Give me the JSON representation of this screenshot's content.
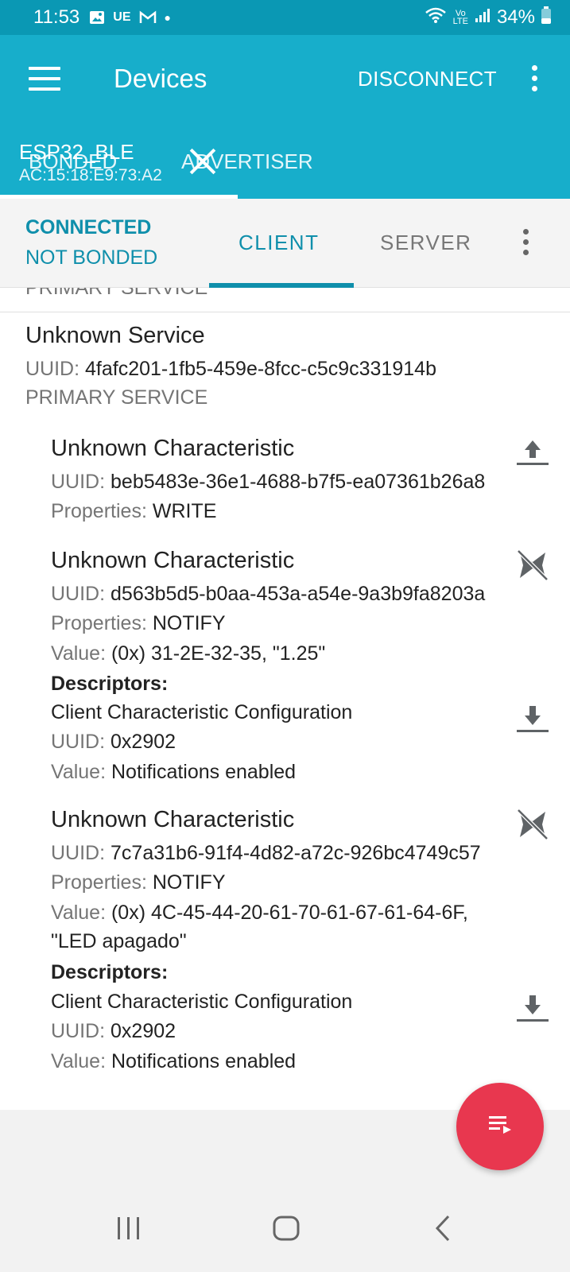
{
  "status_bar": {
    "time": "11:53",
    "carrier": "UE",
    "battery": "34%",
    "lte_top": "Vo",
    "lte_bottom": "LTE"
  },
  "app_bar": {
    "title": "Devices",
    "disconnect_label": "DISCONNECT"
  },
  "device_tabs": {
    "bonded": "BONDED",
    "advertiser": "ADVERTISER",
    "device_name": "ESP32_BLE",
    "device_address": "AC:15:18:E9:73:A2"
  },
  "connection": {
    "status": "CONNECTED",
    "bond": "NOT BONDED",
    "tab_client": "CLIENT",
    "tab_server": "SERVER"
  },
  "content": {
    "cut_label": "PRIMARY SERVICE",
    "service": {
      "name": "Unknown Service",
      "uuid_label": "UUID:",
      "uuid": "4fafc201-1fb5-459e-8fcc-c5c9c331914b",
      "type": "PRIMARY SERVICE"
    },
    "characteristics": [
      {
        "name": "Unknown Characteristic",
        "uuid_label": "UUID:",
        "uuid": "beb5483e-36e1-4688-b7f5-ea07361b26a8",
        "properties_label": "Properties:",
        "properties": "WRITE",
        "icon": "upload-icon"
      },
      {
        "name": "Unknown Characteristic",
        "uuid_label": "UUID:",
        "uuid": "d563b5d5-b0aa-453a-a54e-9a3b9fa8203a",
        "properties_label": "Properties:",
        "properties": "NOTIFY",
        "value_label": "Value:",
        "value": "(0x) 31-2E-32-35, \"1.25\"",
        "descriptors_label": "Descriptors:",
        "descriptor_name": "Client Characteristic Configuration",
        "descriptor_uuid_label": "UUID:",
        "descriptor_uuid": "0x2902",
        "descriptor_value_label": "Value:",
        "descriptor_value": "Notifications enabled",
        "icon": "notifications-off-icon"
      },
      {
        "name": "Unknown Characteristic",
        "uuid_label": "UUID:",
        "uuid": "7c7a31b6-91f4-4d82-a72c-926bc4749c57",
        "properties_label": "Properties:",
        "properties": "NOTIFY",
        "value_label": "Value:",
        "value_line1": "(0x) 4C-45-44-20-61-70-61-67-61-64-6F,",
        "value_line2": "\"LED apagado\"",
        "descriptors_label": "Descriptors:",
        "descriptor_name": "Client Characteristic Configuration",
        "descriptor_uuid_label": "UUID:",
        "descriptor_uuid": "0x2902",
        "descriptor_value_label": "Value:",
        "descriptor_value": "Notifications enabled",
        "icon": "notifications-off-icon"
      }
    ]
  },
  "colors": {
    "status_bar": "#0a98b4",
    "app_bar": "#17aecb",
    "accent": "#0f8fab",
    "fab": "#e8374f"
  }
}
